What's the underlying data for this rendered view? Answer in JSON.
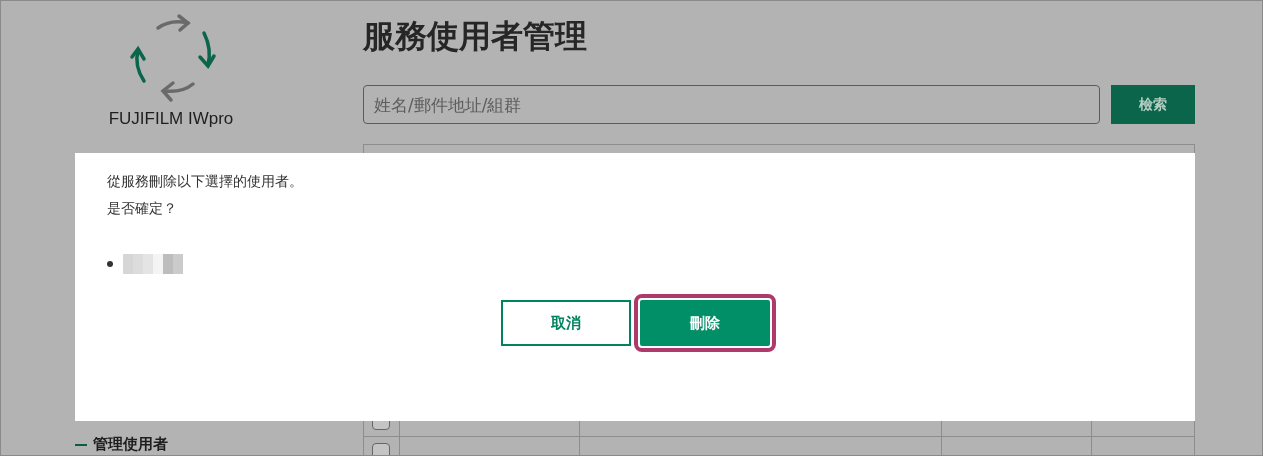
{
  "sidebar": {
    "logo_text": "FUJIFILM IWpro",
    "items": [
      {
        "label": "管理使用者",
        "selected": true
      }
    ]
  },
  "page": {
    "title": "服務使用者管理",
    "search": {
      "placeholder": "姓名/郵件地址/組群",
      "button": "檢索"
    },
    "table": {
      "rows": [
        {
          "checked": false
        },
        {
          "checked": false
        }
      ]
    }
  },
  "dialog": {
    "message": "從服務刪除以下選擇的使用者。",
    "question": "是否確定？",
    "items": [
      {
        "kind": "redacted"
      }
    ],
    "buttons": [
      {
        "label": "取消",
        "kind": "secondary",
        "focused": false
      },
      {
        "label": "刪除",
        "kind": "primary",
        "focused": true
      }
    ]
  }
}
